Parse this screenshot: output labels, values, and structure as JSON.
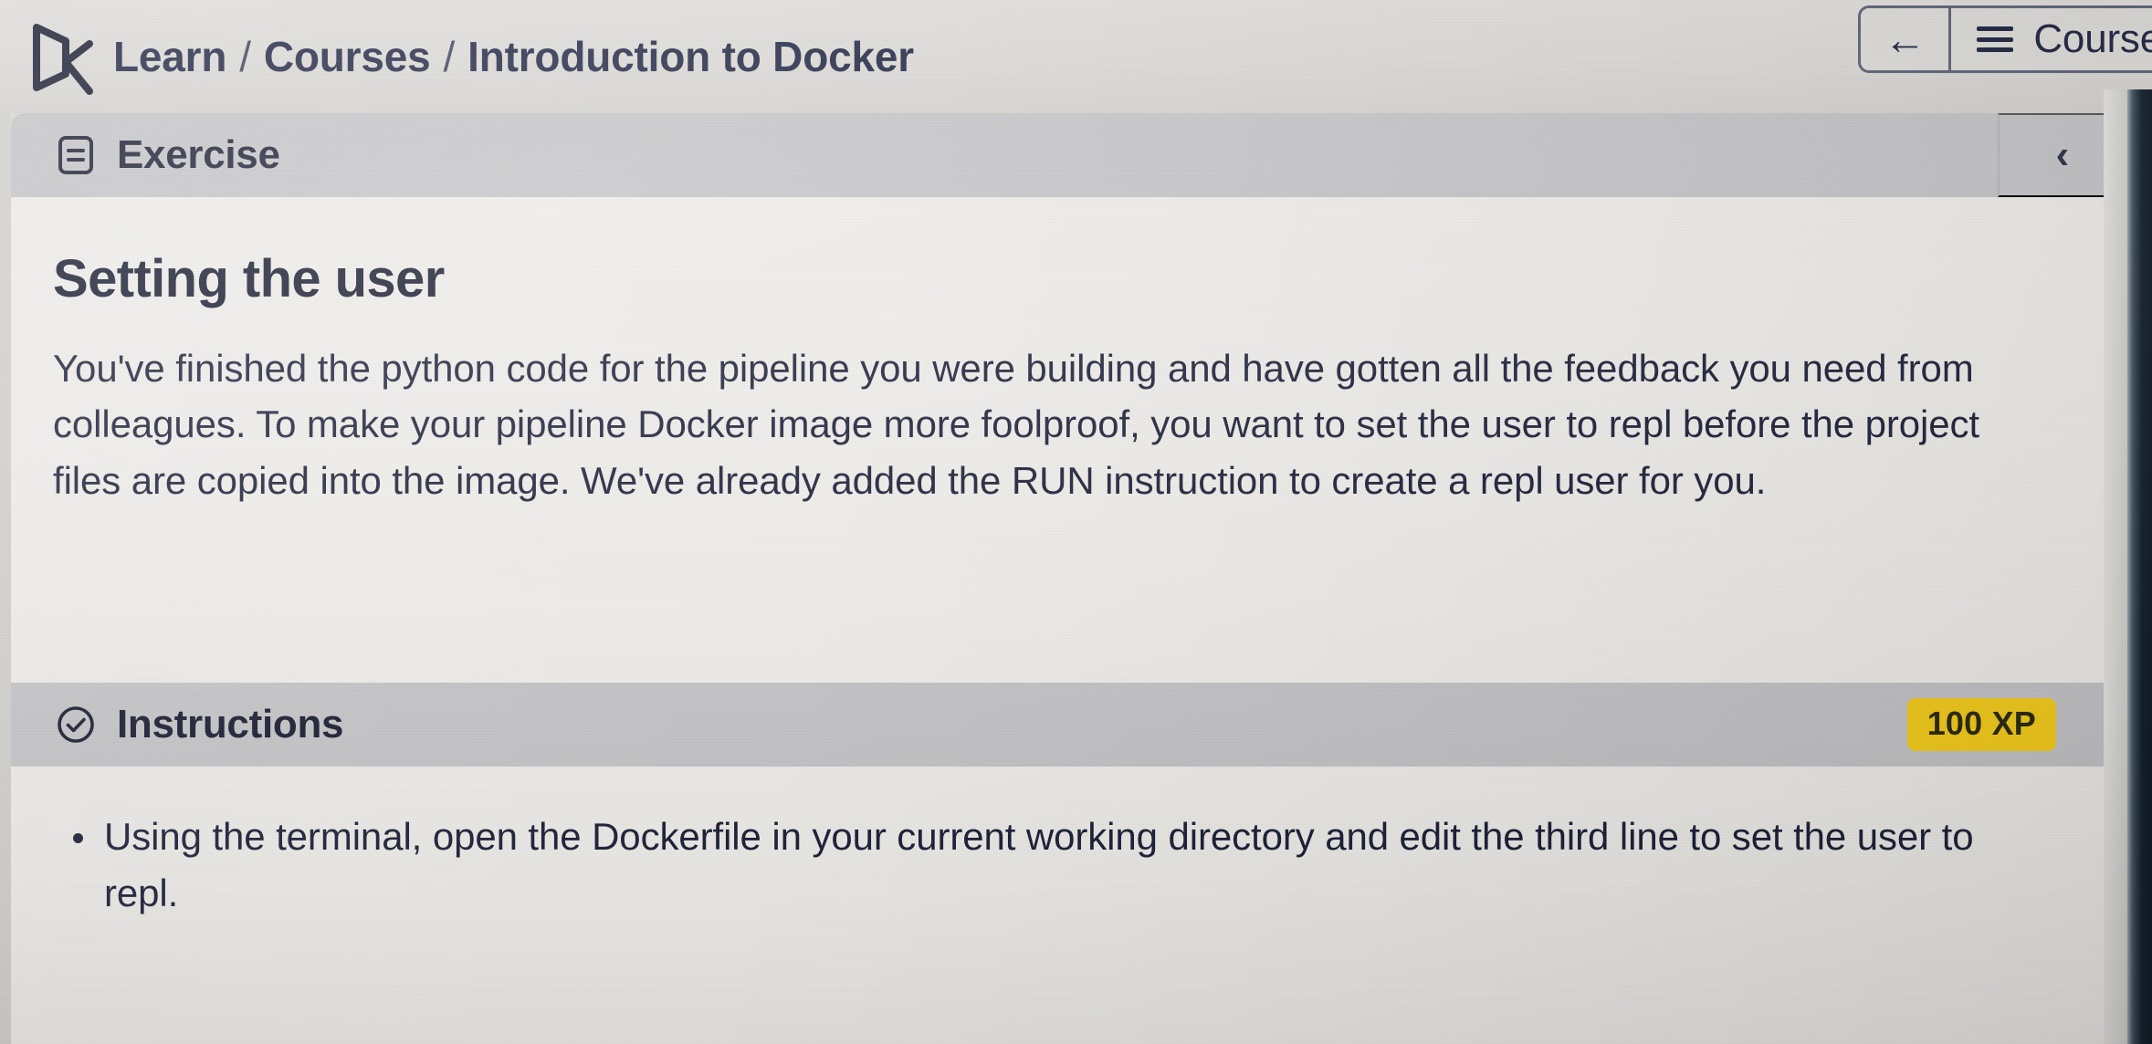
{
  "topbar": {
    "logo_icon": "datacamp-logo-icon",
    "breadcrumb": {
      "items": [
        "Learn",
        "Courses",
        "Introduction to Docker"
      ],
      "separator": "/"
    },
    "back_button": {
      "icon": "arrow-left-icon",
      "label": "←"
    },
    "courses_button": {
      "icon": "hamburger-menu-icon",
      "label": "Course"
    }
  },
  "exercise": {
    "header": {
      "icon": "document-lines-icon",
      "label": "Exercise",
      "collapse_icon": "chevron-left-icon"
    },
    "title": "Setting the user",
    "description": "You've finished the python code for the pipeline you were building and have gotten all the feedback you need from colleagues. To make your pipeline Docker image more foolproof, you want to set the user to repl before the project files are copied into the image. We've already added the RUN instruction to create a repl user for you."
  },
  "instructions": {
    "header": {
      "icon": "check-circle-icon",
      "label": "Instructions",
      "xp_badge": "100 XP"
    },
    "items": [
      "Using the terminal, open the Dockerfile in your current working directory and edit the third line to set the user to repl."
    ]
  },
  "colors": {
    "page_background": "#d9d7d4",
    "panel_background": "#eceae7",
    "section_bar": "#c2c2c5",
    "text_primary": "#1c2038",
    "xp_badge_background": "#f2ca1b",
    "xp_badge_text": "#2c2a10",
    "editor_strip": "#13202e"
  }
}
